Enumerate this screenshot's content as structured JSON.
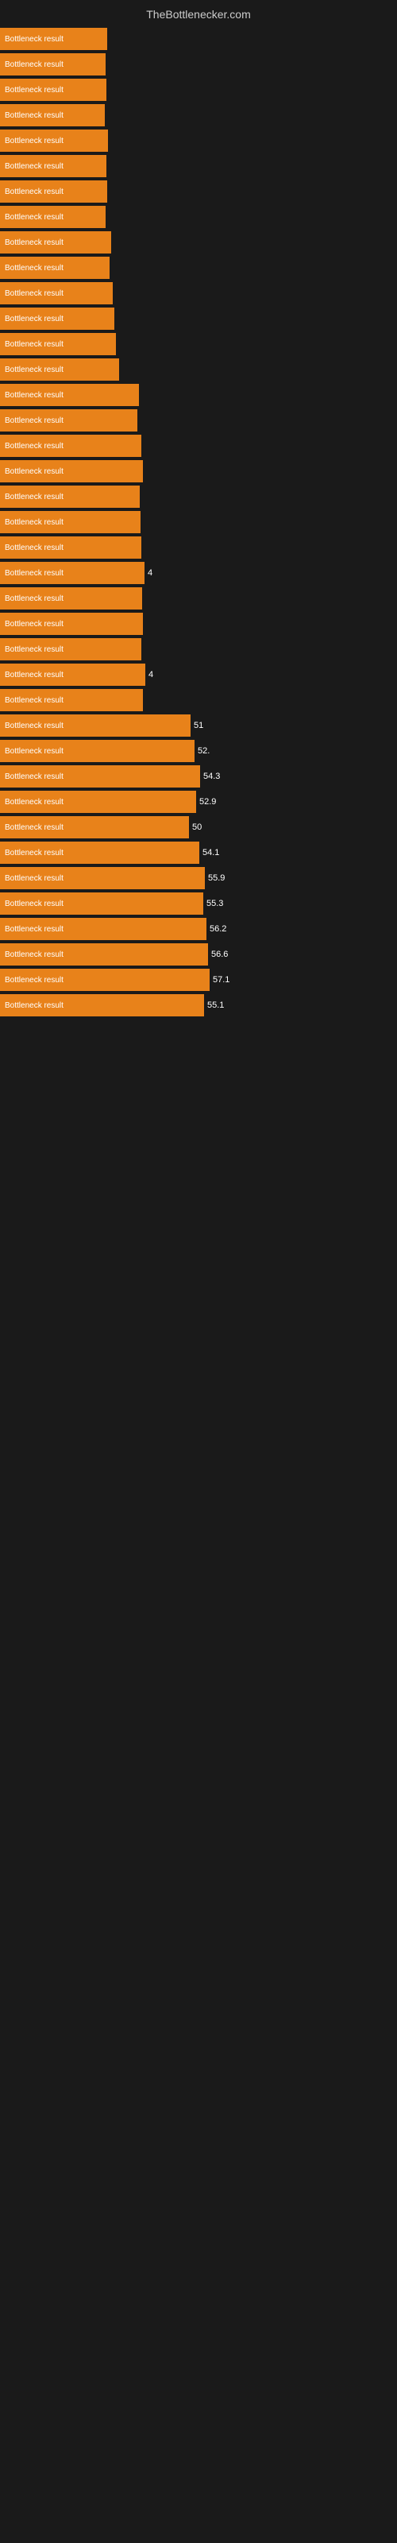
{
  "header": {
    "title": "TheBottlenecker.com"
  },
  "bars": [
    {
      "label": "Bottleneck result",
      "value": null,
      "width": 15
    },
    {
      "label": "Bottleneck result",
      "value": null,
      "width": 13
    },
    {
      "label": "Bottleneck result",
      "value": null,
      "width": 14
    },
    {
      "label": "Bottleneck result",
      "value": null,
      "width": 12
    },
    {
      "label": "Bottleneck result",
      "value": null,
      "width": 16
    },
    {
      "label": "Bottleneck result",
      "value": null,
      "width": 14
    },
    {
      "label": "Bottleneck result",
      "value": null,
      "width": 15
    },
    {
      "label": "Bottleneck result",
      "value": null,
      "width": 13
    },
    {
      "label": "Bottleneck result",
      "value": null,
      "width": 20
    },
    {
      "label": "Bottleneck result",
      "value": null,
      "width": 18
    },
    {
      "label": "Bottleneck result",
      "value": null,
      "width": 22
    },
    {
      "label": "Bottleneck result",
      "value": null,
      "width": 24
    },
    {
      "label": "Bottleneck result",
      "value": null,
      "width": 26
    },
    {
      "label": "Bottleneck result",
      "value": null,
      "width": 30
    },
    {
      "label": "Bottleneck result",
      "value": null,
      "width": 55
    },
    {
      "label": "Bottleneck result",
      "value": null,
      "width": 53
    },
    {
      "label": "Bottleneck result",
      "value": null,
      "width": 58
    },
    {
      "label": "Bottleneck result",
      "value": null,
      "width": 60
    },
    {
      "label": "Bottleneck result",
      "value": null,
      "width": 56
    },
    {
      "label": "Bottleneck result",
      "value": null,
      "width": 57
    },
    {
      "label": "Bottleneck result",
      "value": null,
      "width": 58
    },
    {
      "label": "Bottleneck result",
      "value": "4",
      "width": 62
    },
    {
      "label": "Bottleneck result",
      "value": null,
      "width": 59
    },
    {
      "label": "Bottleneck result",
      "value": null,
      "width": 60
    },
    {
      "label": "Bottleneck result",
      "value": null,
      "width": 58
    },
    {
      "label": "Bottleneck result",
      "value": "4",
      "width": 63
    },
    {
      "label": "Bottleneck result",
      "value": null,
      "width": 60
    },
    {
      "label": "Bottleneck result",
      "value": "51",
      "width": 120
    },
    {
      "label": "Bottleneck result",
      "value": "52.",
      "width": 125
    },
    {
      "label": "Bottleneck result",
      "value": "54.3",
      "width": 132
    },
    {
      "label": "Bottleneck result",
      "value": "52.9",
      "width": 127
    },
    {
      "label": "Bottleneck result",
      "value": "50",
      "width": 118
    },
    {
      "label": "Bottleneck result",
      "value": "54.1",
      "width": 131
    },
    {
      "label": "Bottleneck result",
      "value": "55.9",
      "width": 138
    },
    {
      "label": "Bottleneck result",
      "value": "55.3",
      "width": 136
    },
    {
      "label": "Bottleneck result",
      "value": "56.2",
      "width": 140
    },
    {
      "label": "Bottleneck result",
      "value": "56.6",
      "width": 142
    },
    {
      "label": "Bottleneck result",
      "value": "57.1",
      "width": 144
    },
    {
      "label": "Bottleneck result",
      "value": "55.1",
      "width": 137
    }
  ]
}
